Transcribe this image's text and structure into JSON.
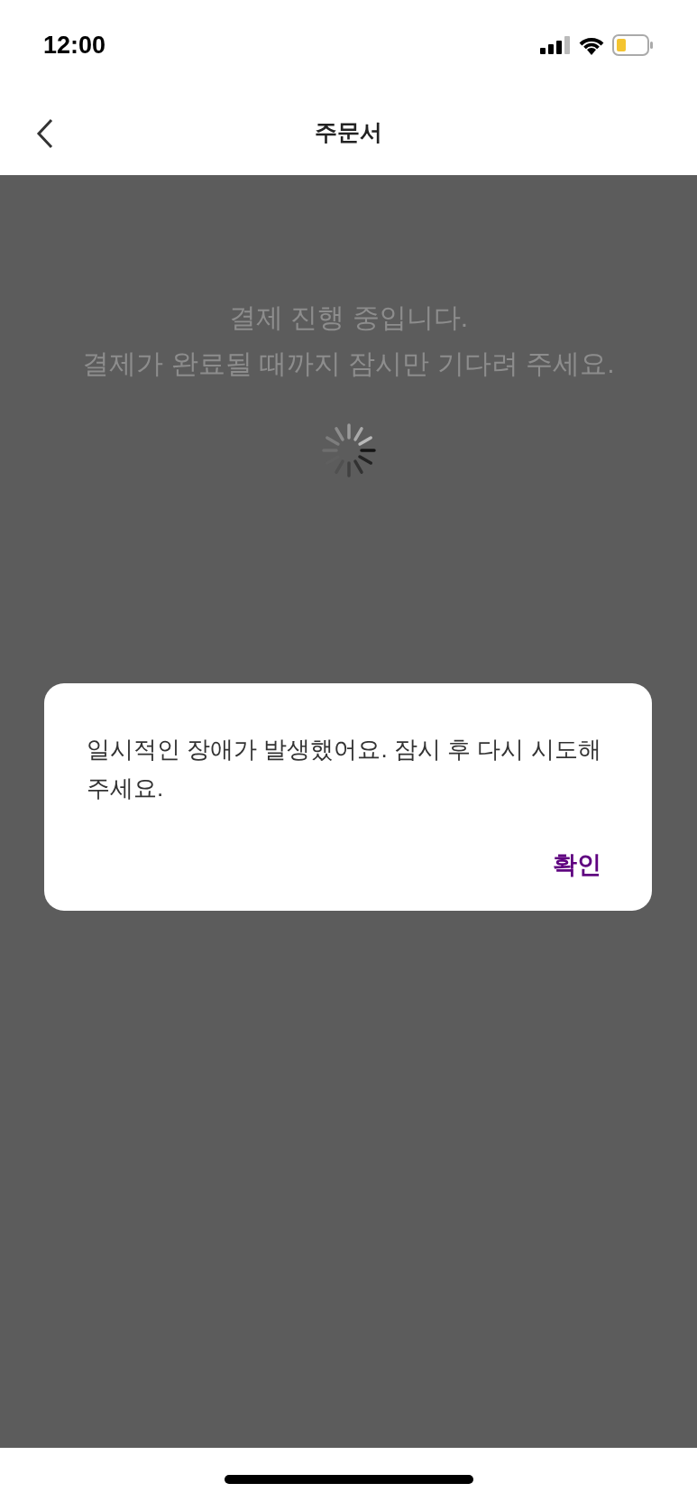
{
  "status_bar": {
    "time": "12:00"
  },
  "nav": {
    "title": "주문서"
  },
  "loading": {
    "lines": [
      "결제 진행 중입니다.",
      "결제가 완료될 때까지 잠시만 기다려 주세요."
    ]
  },
  "dialog": {
    "message": "일시적인 장애가 발생했어요. 잠시 후 다시 시도해주세요.",
    "buttons": [
      "확인"
    ]
  }
}
